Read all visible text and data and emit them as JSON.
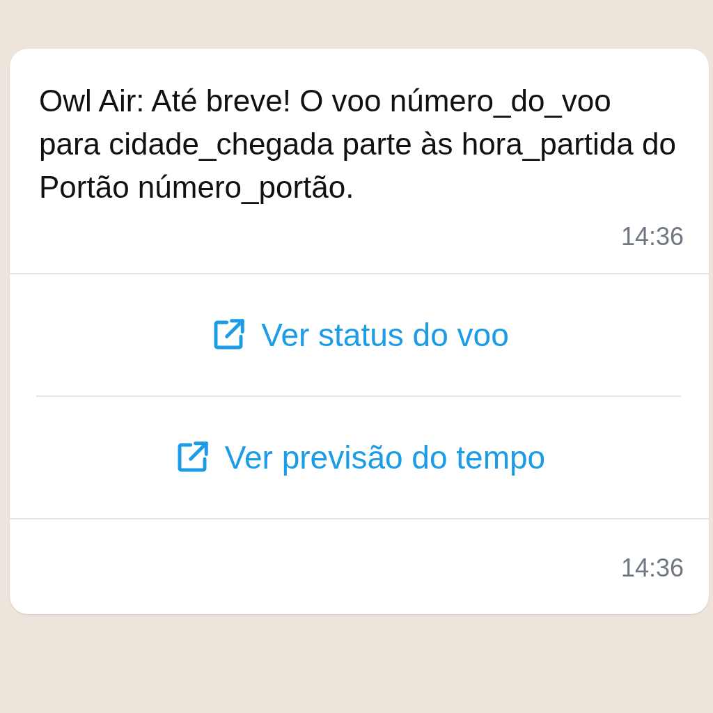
{
  "message": {
    "text": "Owl Air: Até breve! O voo número_do_voo para cidade_chegada parte às hora_partida do Portão número_portão.",
    "time": "14:36"
  },
  "buttons": [
    {
      "label": "Ver status do voo"
    },
    {
      "label": "Ver previsão do tempo"
    }
  ],
  "footer": {
    "time": "14:36"
  }
}
